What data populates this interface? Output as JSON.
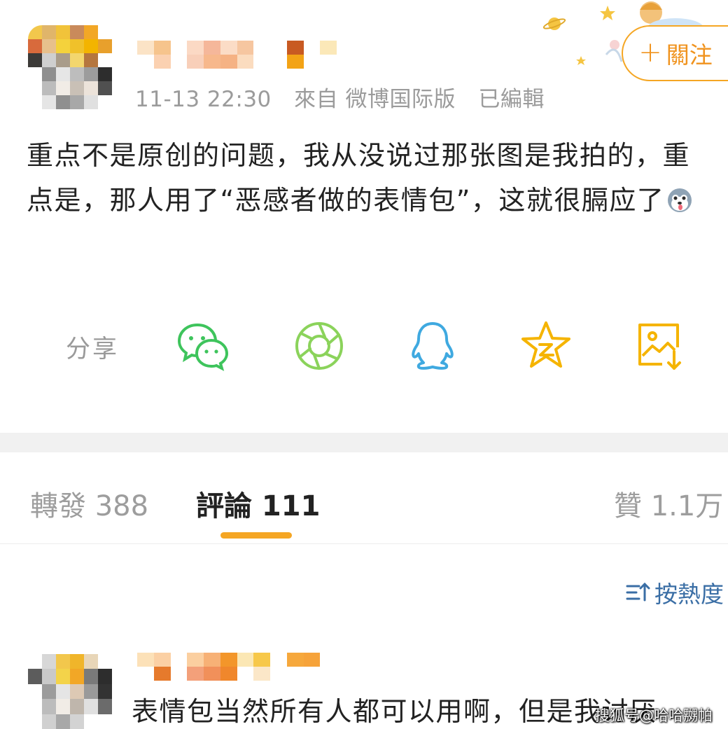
{
  "post": {
    "timestamp": "11-13 22:30",
    "source": "來自 微博国际版",
    "edited": "已編輯",
    "follow_label": "關注",
    "body": "重点不是原创的问题，我从没说过那张图是我拍的，重点是，那人用了“恶感者做的表情包”，这就很膈应了"
  },
  "share": {
    "label": "分享",
    "targets": [
      "wechat-icon",
      "moments-icon",
      "qq-icon",
      "qzone-icon",
      "save-image-icon"
    ]
  },
  "tabs": {
    "repost": "轉發 388",
    "comments": "評論 111",
    "likes": "贊 1.1万"
  },
  "sort": {
    "label": "按熱度"
  },
  "comment": {
    "text": "表情包当然所有人都可以用啊，但是我讨厌"
  },
  "watermark": "搜狐号@哈哈嬲帕",
  "colors": {
    "accent": "#f5a623",
    "wechat": "#3ec45c",
    "moments": "#8bd35b",
    "qq": "#3fa9e0",
    "qzone": "#f5b400",
    "link": "#3a6ea5"
  }
}
